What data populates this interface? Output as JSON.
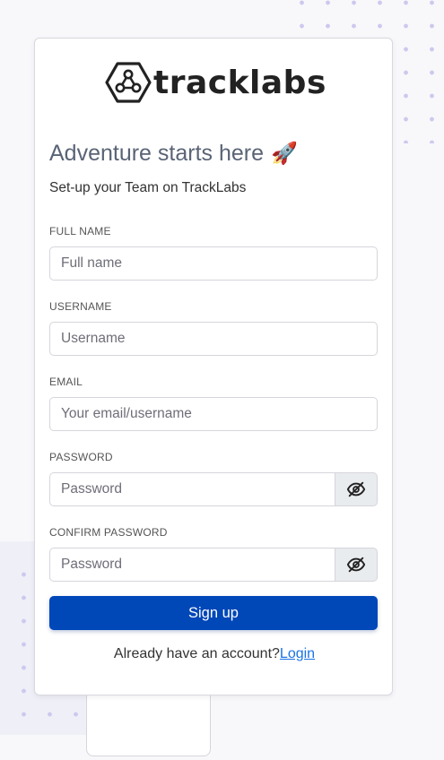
{
  "brand": {
    "name": "tracklabs",
    "icon": "hexagon-network-logo"
  },
  "heading": {
    "title": "Adventure starts here",
    "emoji": "🚀",
    "subtitle": "Set-up your Team on TrackLabs"
  },
  "form": {
    "full_name": {
      "label": "FULL NAME",
      "placeholder": "Full name"
    },
    "username": {
      "label": "USERNAME",
      "placeholder": "Username"
    },
    "email": {
      "label": "EMAIL",
      "placeholder": "Your email/username"
    },
    "password": {
      "label": "PASSWORD",
      "placeholder": "Password",
      "toggle_icon": "eye-slash-icon"
    },
    "confirm_password": {
      "label": "CONFIRM PASSWORD",
      "placeholder": "Password",
      "toggle_icon": "eye-slash-icon"
    },
    "submit_label": "Sign up"
  },
  "footer": {
    "prompt": "Already have an account?",
    "login_link": "Login"
  },
  "colors": {
    "primary": "#0047b8",
    "link": "#1a73e8",
    "heading": "#5a6476",
    "dots": "#cdc9ee"
  }
}
